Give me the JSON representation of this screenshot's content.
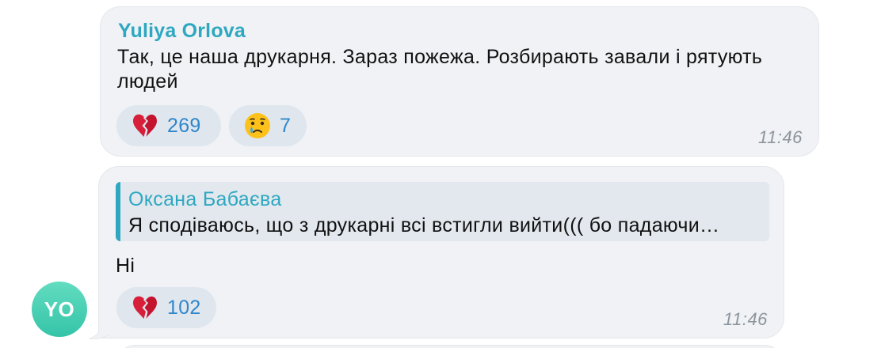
{
  "messages": [
    {
      "sender": "Yuliya Orlova",
      "text": "Так, це наша друкарня. Зараз пожежа. Розбирають завали і рятують людей",
      "reactions": [
        {
          "icon": "broken-heart-icon",
          "count": "269"
        },
        {
          "icon": "crying-face-icon",
          "count": "7"
        }
      ],
      "time": "11:46"
    },
    {
      "reply": {
        "name": "Оксана Бабаєва",
        "text": "Я сподіваюсь, що з друкарні всі встигли вийти((( бо падаючи…"
      },
      "text": "Ні",
      "reactions": [
        {
          "icon": "broken-heart-icon",
          "count": "102"
        }
      ],
      "time": "11:46"
    }
  ],
  "avatar": {
    "initials": "YO",
    "color": "#3fcbaf"
  },
  "colors": {
    "accent": "#2ea8c1",
    "reaction_count": "#2f86c9",
    "bubble": "#f0f2f5",
    "reaction_bg": "#dfe6ee",
    "time": "#8d959e"
  }
}
